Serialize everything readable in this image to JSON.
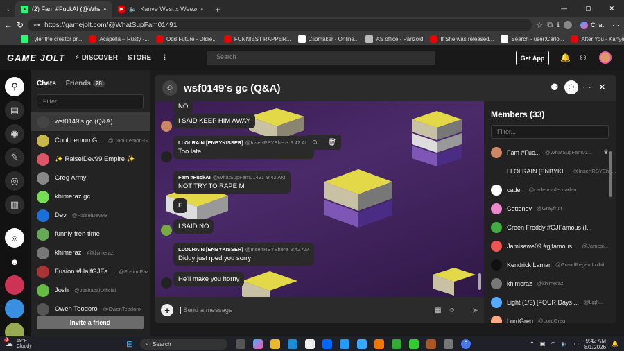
{
  "tabs": [
    {
      "label": "(2) Fam #FuckAI (@WhatSupFam0",
      "close": "×",
      "active": true
    },
    {
      "label": "Kanye West x Weezer - Yeeze",
      "close": "×",
      "active": false
    }
  ],
  "window_controls": {
    "minimize": "—",
    "maximize": "▢",
    "close": "✕"
  },
  "address": {
    "url": "https://gamejolt.com/@WhatSupFam01491",
    "profile_label": "Chat"
  },
  "bookmarks": [
    "Tyler the creator pr...",
    "Acapella – Rusty -...",
    "Odd Future - Oldie...",
    "FUNNIEST RAPPER...",
    "Clipmaker - Online...",
    "AS office - Panzoid",
    "If She was released...",
    "Search - user:Carlo...",
    "After You - Kanye..."
  ],
  "gj_header": {
    "logo": "GAME JOLT",
    "discover": "DISCOVER",
    "store": "STORE",
    "more": "⋮",
    "search_placeholder": "Search",
    "get_app": "Get App"
  },
  "chats": {
    "tab_chats": "Chats",
    "tab_friends": "Friends",
    "friends_count": "28",
    "filter_placeholder": "Filter...",
    "items": [
      {
        "name": "wsf0149's gc (Q&A)",
        "handle": "",
        "active": true
      },
      {
        "name": "Cool Lemon G...",
        "handle": "@Cool-Lemon-G..."
      },
      {
        "name": "✨ RalseiDev99 Empire ✨",
        "handle": ""
      },
      {
        "name": "Greg Army",
        "handle": ""
      },
      {
        "name": "khimeraz gc",
        "handle": ""
      },
      {
        "name": "Dev",
        "handle": "@RalseiDev99"
      },
      {
        "name": "funnly fren time",
        "handle": ""
      },
      {
        "name": "khimeraz",
        "handle": "@khimeraz"
      },
      {
        "name": "Fusion #HalfGJFa...",
        "handle": "@FusionFaz..."
      },
      {
        "name": "Josh",
        "handle": "@JoshacaiOfficial"
      },
      {
        "name": "Owen Teodoro",
        "handle": "@OwenTeodoro"
      }
    ],
    "invite": "Invite a friend"
  },
  "chat_window": {
    "title": "wsf0149's gc (Q&A)",
    "close": "✕",
    "messages": [
      {
        "text": "NO"
      },
      {
        "text": "I SAID KEEP HIM AWAY"
      },
      {
        "author": "LLOLRAIN [ENBYKISSER]",
        "handle": "@InsertRSYEhere",
        "time": "9:42 AM",
        "text": "Too late"
      },
      {
        "author": "Fam #FuckAI",
        "handle": "@WhatSupFam01491",
        "time": "9:42 AM",
        "text": "NOT TRY TO RAPE M"
      },
      {
        "text": "E"
      },
      {
        "text": "I SAID NO"
      },
      {
        "author": "LLOLRAIN [ENBYKISSER]",
        "handle": "@InsertRSYEhere",
        "time": "9:42 AM",
        "text": "Diddy just rped you sorry"
      },
      {
        "text": "He'll make you horny"
      }
    ],
    "input_placeholder": "Send a message"
  },
  "members": {
    "title": "Members (33)",
    "filter_placeholder": "Filter...",
    "items": [
      {
        "name": "Fam #Fuc...",
        "handle": "@WhatSupFam01..."
      },
      {
        "name": "LLOLRAIN [ENBYKI...",
        "handle": "@InsertRSYEhe..."
      },
      {
        "name": "caden",
        "handle": "@cadencadencaden"
      },
      {
        "name": "Cottoney",
        "handle": "@Grayfruit"
      },
      {
        "name": "Green Freddy #GJFamous (I...",
        "handle": ""
      },
      {
        "name": "Jamisawe09 #gjfamous...",
        "handle": "@Jamesi..."
      },
      {
        "name": "Kendrick Lamar",
        "handle": "@GrandRegentLolbit"
      },
      {
        "name": "khimeraz",
        "handle": "@khimeraz"
      },
      {
        "name": "Light (1/3) [FOUR Days ...",
        "handle": "@Ligh..."
      },
      {
        "name": "LordGreg",
        "handle": "@LordGreg"
      }
    ]
  },
  "taskbar": {
    "weather_temp": "69°F",
    "weather_desc": "Cloudy",
    "weather_badge": "3",
    "search": "Search",
    "time": "9:42 AM",
    "date": "8/1/2026"
  }
}
